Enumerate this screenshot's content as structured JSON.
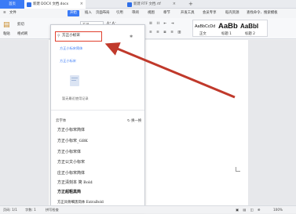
{
  "tabs": {
    "home": "首页",
    "doc": "新建 DOCX 文档.docx",
    "rtf": "新建 RTF 文档.rtf",
    "plus": "+"
  },
  "menu": {
    "hamburger": "≡",
    "file": "文件",
    "items": [
      "开始",
      "插入",
      "页面布局",
      "引用",
      "审阅",
      "视图",
      "章节",
      "开发工具",
      "会员专享",
      "稻壳资源",
      "查找命令、搜索模板"
    ],
    "active_index": 0
  },
  "toolbar": {
    "paste": "粘贴",
    "cut": "剪切",
    "format_painter": "格式刷",
    "font_size_value": "五号",
    "zoom": "A⁺ A⁻",
    "styles": {
      "normal": "AaBbCcDd",
      "normal_label": "正文",
      "h1": "AaBb",
      "h1_label": "标题 1",
      "h2": "AaBbI",
      "h2_label": "标题 2"
    }
  },
  "font_panel": {
    "search_value": "方正小标宋",
    "search_icon": "search-icon",
    "settings_icon": "gear-icon",
    "recent": [
      "方正小标宋简体",
      "方正小标宋"
    ],
    "empty_text": "暂无最近使用记录",
    "cloud_title": "云字体",
    "refresh": "换一换",
    "fonts": [
      "方正小标宋简体",
      "方正小标宋_GBK",
      "方正小标宋体",
      "方正公文小标宋",
      "庄正小标宋简体",
      "方正清刻本 简 Bold",
      "方正超粗黑简",
      "方正风骨细黑简体 ExtraBold"
    ]
  },
  "status": {
    "page": "页码: 1/1",
    "section": "字数: 1",
    "spellcheck": "拼写检查",
    "zoom_value": "100%"
  },
  "colors": {
    "accent": "#3b7bf6",
    "highlight": "#e0402e",
    "arrow": "#c0392b"
  }
}
